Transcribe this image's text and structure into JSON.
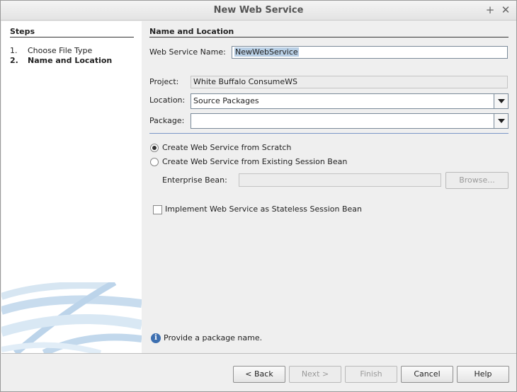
{
  "window": {
    "title": "New Web Service",
    "maximize_icon": "plus-icon",
    "close_icon": "close-icon"
  },
  "steps": {
    "heading": "Steps",
    "items": [
      {
        "number": "1.",
        "label": "Choose File Type",
        "current": false
      },
      {
        "number": "2.",
        "label": "Name and Location",
        "current": true
      }
    ]
  },
  "panel": {
    "heading": "Name and Location",
    "web_service_name": {
      "label": "Web Service Name:",
      "value": "NewWebService"
    },
    "project": {
      "label": "Project:",
      "value": "White Buffalo ConsumeWS"
    },
    "location": {
      "label": "Location:",
      "value": "Source Packages"
    },
    "package": {
      "label": "Package:",
      "value": ""
    },
    "options": [
      {
        "label": "Create Web Service from Scratch",
        "selected": true
      },
      {
        "label": "Create Web Service from Existing Session Bean",
        "selected": false
      }
    ],
    "enterprise_bean": {
      "label": "Enterprise Bean:",
      "value": "",
      "browse_label": "Browse..."
    },
    "stateless_checkbox": {
      "label": "Implement Web Service as Stateless Session Bean",
      "checked": false
    },
    "message": "Provide a package name."
  },
  "buttons": {
    "back": "< Back",
    "next": "Next >",
    "finish": "Finish",
    "cancel": "Cancel",
    "help": "Help"
  }
}
